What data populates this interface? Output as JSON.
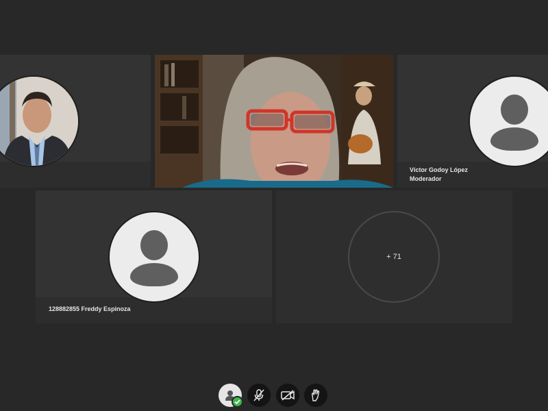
{
  "participants": [
    {
      "name": "",
      "role": "",
      "avatar": "photo-man"
    },
    {
      "name": "",
      "role": "",
      "avatar": "video-woman-speaking"
    },
    {
      "name": "Víctor Godoy López",
      "role": "Moderador",
      "avatar": "default-user-icon"
    },
    {
      "name": "128882855 Freddy Espinoza",
      "role": "",
      "avatar": "default-user-icon"
    }
  ],
  "overflow": {
    "label": "+ 71"
  },
  "controls": {
    "user_status": "user-icon",
    "mic": "microphone-muted-icon",
    "camera": "camera-off-icon",
    "hand": "raise-hand-icon"
  },
  "colors": {
    "background": "#282828",
    "tile": "#333333",
    "status_ok": "#3cb84a"
  }
}
